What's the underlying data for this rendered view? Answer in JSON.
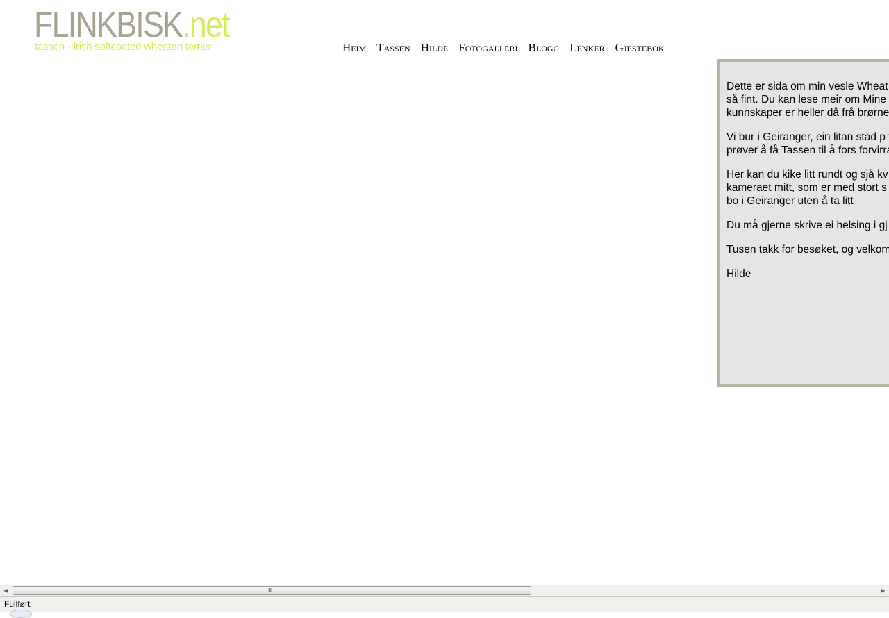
{
  "logo": {
    "word": "FLINKBISK",
    "tld": ".net",
    "tagline": "tassen - irish softcoated wheaten terrier"
  },
  "nav": {
    "items": [
      "Heim",
      "Tassen",
      "Hilde",
      "Fotogalleri",
      "Blogg",
      "Lenker",
      "Gjestebok"
    ]
  },
  "content": {
    "paragraphs": [
      "Dette er sida om min vesle Wheat heiter så fint. Du kan lese meir om Mine html-kunnskaper er heller då frå brørne mine.",
      "Vi bur i Geiranger, ein litan stad p fortvila prøver å få Tassen til å fors forvirra rådyr.",
      "Her kan du kike litt rundt og sjå kv kameraet mitt, som er med stort s jo ikkje bo i Geiranger uten å ta litt",
      "Du må gjerne skrive ei helsing i gj",
      "Tusen takk for besøket, og velkom",
      "Hilde"
    ]
  },
  "scrollbar": {
    "left_arrow": "◀",
    "right_arrow": "▶",
    "grip": "III"
  },
  "status": {
    "text": "Fullført"
  },
  "colors": {
    "logo_grey": "#a7a391",
    "logo_lime": "#d8ea56",
    "box_bg": "#e6e4e5",
    "box_border": "#b8b3a3"
  }
}
